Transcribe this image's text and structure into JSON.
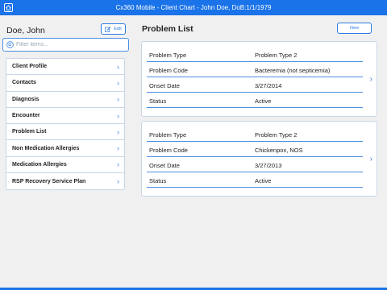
{
  "window": {
    "title": "Cx360 Mobile - Client Chart - John Doe, DoB:1/1/1979"
  },
  "sidebar": {
    "patient_name": "Doe, John",
    "edit_label": "Edit",
    "filter_placeholder": "Filter items...",
    "items": [
      {
        "label": "Client Profile"
      },
      {
        "label": "Contacts"
      },
      {
        "label": "Diagnosis"
      },
      {
        "label": "Encounter"
      },
      {
        "label": "Problem List"
      },
      {
        "label": "Non Medication Allergies"
      },
      {
        "label": "Medication Allergies"
      },
      {
        "label": "RSP Recovery Service Plan"
      }
    ]
  },
  "main": {
    "title": "Problem List",
    "new_label": "New",
    "problems": [
      {
        "rows": [
          {
            "key": "Problem Type",
            "value": "Problem Type 2"
          },
          {
            "key": "Problem Code",
            "value": "Bacteremia (not septicemia)"
          },
          {
            "key": "Onset Date",
            "value": "3/27/2014"
          },
          {
            "key": "Status",
            "value": "Active"
          }
        ]
      },
      {
        "rows": [
          {
            "key": "Problem Type",
            "value": "Problem Type 2"
          },
          {
            "key": "Problem Code",
            "value": "Chickenpox, NOS"
          },
          {
            "key": "Onset Date",
            "value": "3/27/2013"
          },
          {
            "key": "Status",
            "value": "Active"
          }
        ]
      }
    ]
  },
  "icons": {
    "home": "home-icon",
    "edit": "pencil-icon",
    "search": "search-icon",
    "chevron": "chevron-right-icon"
  },
  "colors": {
    "accent": "#1a73e8",
    "link": "#2a7ae2"
  }
}
